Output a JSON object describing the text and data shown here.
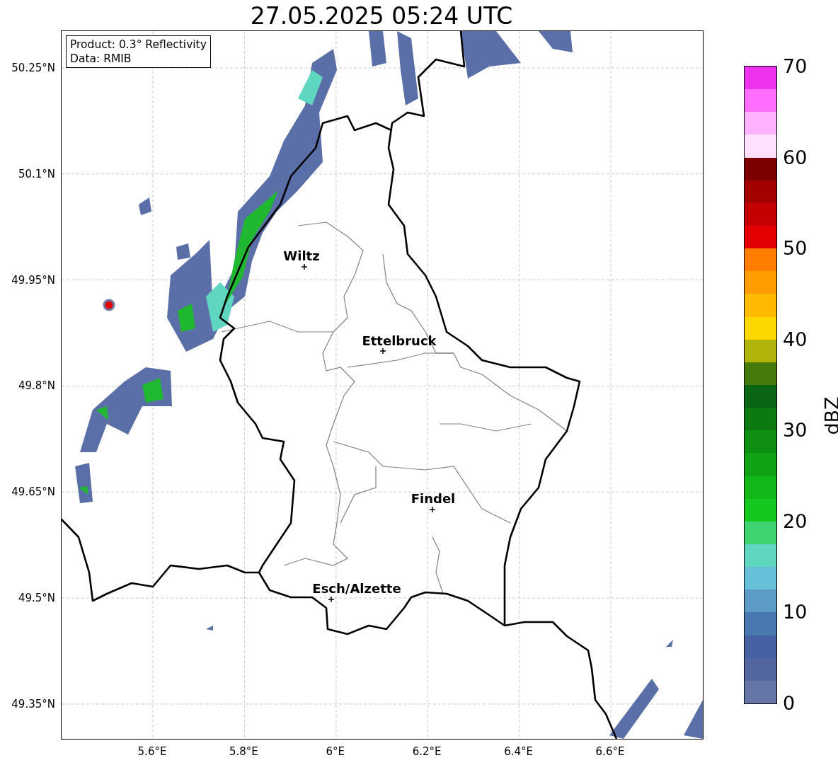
{
  "title": "27.05.2025 05:24 UTC",
  "map": {
    "info": [
      "Product: 0.3° Reflectivity",
      "Data: RMIB"
    ],
    "yticks": [
      "50.25°N",
      "50.1°N",
      "49.95°N",
      "49.8°N",
      "49.65°N",
      "49.5°N",
      "49.35°N"
    ],
    "xticks": [
      "5.6°E",
      "5.8°E",
      "6°E",
      "6.2°E",
      "6.4°E",
      "6.6°E"
    ],
    "places": [
      "Wiltz",
      "Ettelbruck",
      "Findel",
      "Esch/Alzette"
    ]
  },
  "colorbar": {
    "label": "dBZ",
    "ticks": [
      "70",
      "60",
      "50",
      "40",
      "30",
      "20",
      "10",
      "0"
    ],
    "segments": [
      {
        "color": "#ee33ee"
      },
      {
        "color": "#ff6eff"
      },
      {
        "color": "#ffb3ff"
      },
      {
        "color": "#ffe0ff"
      },
      {
        "color": "#7b0000"
      },
      {
        "color": "#a30000"
      },
      {
        "color": "#c40000"
      },
      {
        "color": "#e50000"
      },
      {
        "color": "#ff7d00"
      },
      {
        "color": "#ff9d00"
      },
      {
        "color": "#ffba00"
      },
      {
        "color": "#ffd700"
      },
      {
        "color": "#afb30a"
      },
      {
        "color": "#457a0d"
      },
      {
        "color": "#096512"
      },
      {
        "color": "#0c7a10"
      },
      {
        "color": "#0f8f12"
      },
      {
        "color": "#10a414"
      },
      {
        "color": "#12b818"
      },
      {
        "color": "#14c81e"
      },
      {
        "color": "#3fd46f"
      },
      {
        "color": "#5fd6c0"
      },
      {
        "color": "#66c0d8"
      },
      {
        "color": "#5b9bc6"
      },
      {
        "color": "#4a78b0"
      },
      {
        "color": "#4561a3"
      },
      {
        "color": "#5366a0"
      },
      {
        "color": "#6475a6"
      }
    ]
  }
}
